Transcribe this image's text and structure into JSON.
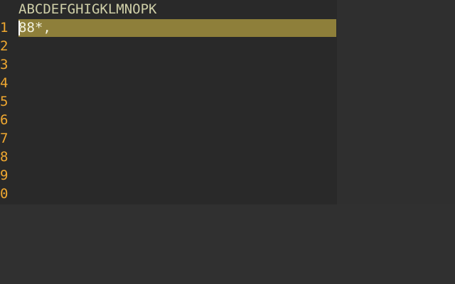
{
  "editor": {
    "column_header": "ABCDEFGHIGKLMNOPK",
    "rows": [
      {
        "number": "1",
        "text": "88*,",
        "selected": true
      },
      {
        "number": "2",
        "text": ""
      },
      {
        "number": "3",
        "text": ""
      },
      {
        "number": "4",
        "text": ""
      },
      {
        "number": "5",
        "text": ""
      },
      {
        "number": "6",
        "text": ""
      },
      {
        "number": "7",
        "text": ""
      },
      {
        "number": "8",
        "text": ""
      },
      {
        "number": "9",
        "text": ""
      },
      {
        "number": "0",
        "text": ""
      }
    ]
  },
  "colors": {
    "editor_background": "#292929",
    "line_number": "#f0a830",
    "text": "#cfcfa8",
    "selection": "#8e7f3a"
  }
}
